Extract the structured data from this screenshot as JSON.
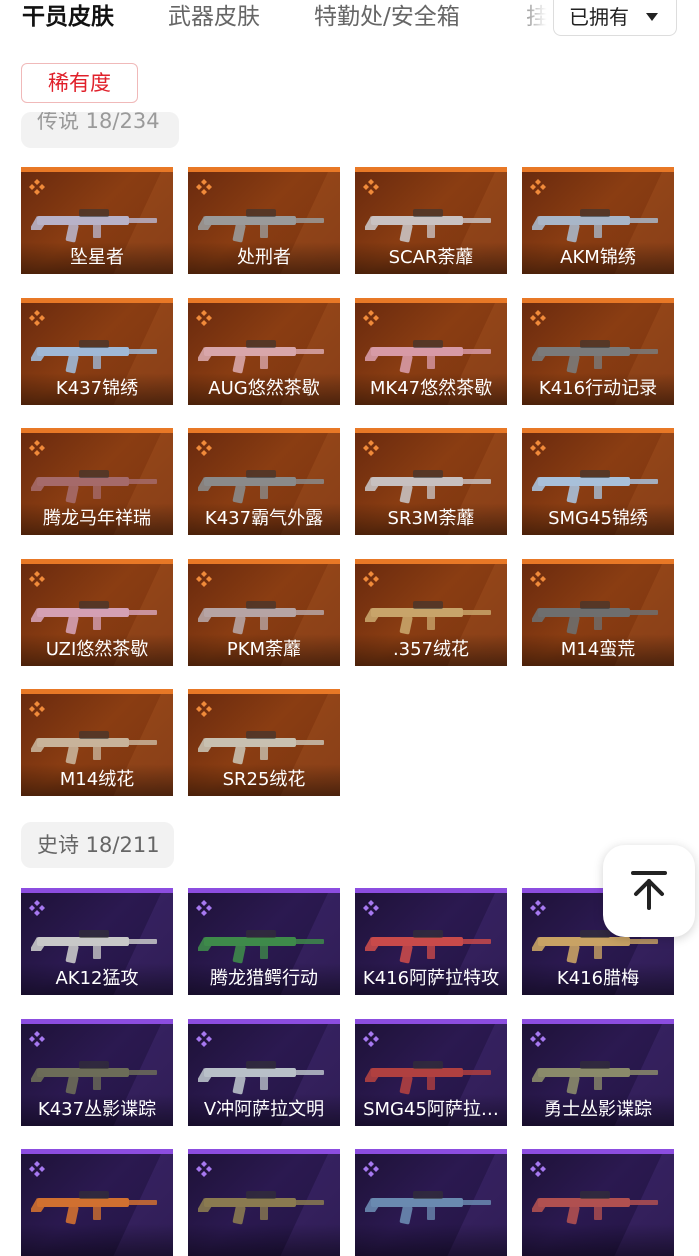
{
  "tabs": [
    "干员皮肤",
    "武器皮肤",
    "特勤处/安全箱",
    "挂"
  ],
  "active_tab": 0,
  "filter": {
    "owned_label": "已拥有",
    "rarity_label": "稀有度"
  },
  "sections": {
    "legend": {
      "label": "传说 18/234"
    },
    "epic": {
      "label": "史诗 18/211"
    }
  },
  "colors": {
    "legend_bar": "#e87826",
    "epic_bar": "#8c4de0",
    "rarity_accent": "#e0202a"
  },
  "legend_items": [
    "坠星者",
    "处刑者",
    "SCAR荼蘼",
    "AKM锦绣",
    "K437锦绣",
    "AUG悠然茶歇",
    "MK47悠然茶歇",
    "K416行动记录",
    "腾龙马年祥瑞",
    "K437霸气外露",
    "SR3M荼蘼",
    "SMG45锦绣",
    "UZI悠然茶歇",
    "PKM荼蘼",
    ".357绒花",
    "M14蛮荒",
    "M14绒花",
    "SR25绒花"
  ],
  "epic_items": [
    "AK12猛攻",
    "腾龙猎鳄行动",
    "K416阿萨拉特攻",
    "K416腊梅",
    "K437丛影谍踪",
    "V冲阿萨拉文明",
    "SMG45阿萨拉…",
    "勇士丛影谍踪",
    "",
    "",
    "",
    ""
  ],
  "icons": {
    "legend_rarity": "diamond-cluster-icon",
    "epic_rarity": "diamond-cluster-icon",
    "back_to_top": "arrow-up-bar-icon",
    "dropdown": "caret-down-icon"
  }
}
